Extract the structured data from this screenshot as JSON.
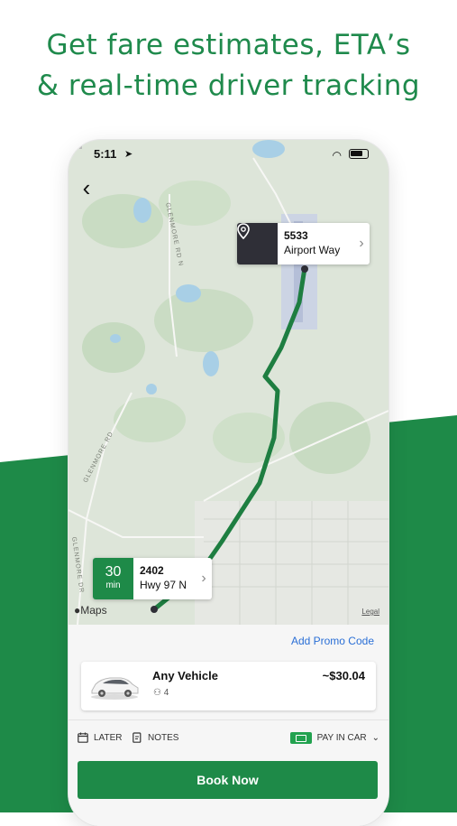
{
  "headline": {
    "line1": "Get fare estimates, ETA’s",
    "line2": "& real-time driver tracking"
  },
  "colors": {
    "brand_green": "#1e8a48",
    "headline_green": "#1f8a4c",
    "link_blue": "#2a6fd6",
    "dest_icon_bg": "#2f2f37"
  },
  "status_bar": {
    "time": "5:11"
  },
  "map": {
    "destination": {
      "line1": "5533",
      "line2": "Airport Way"
    },
    "origin": {
      "eta_value": "30",
      "eta_unit": "min",
      "line1": "2402",
      "line2": "Hwy 97 N"
    },
    "maps_label": "Maps",
    "legal_label": "Legal",
    "road_labels": [
      "GLENMORE RD N",
      "GLENMORE RD",
      "GLENMORE DR"
    ]
  },
  "sheet": {
    "promo_label": "Add Promo Code",
    "vehicle": {
      "name": "Any Vehicle",
      "seats": "4",
      "price": "~$30.04"
    },
    "options": {
      "later": "LATER",
      "notes": "NOTES",
      "payment": "PAY IN CAR"
    },
    "book_label": "Book Now"
  },
  "icons": [
    "location-arrow-icon",
    "signal-icon",
    "wifi-icon",
    "battery-icon",
    "back-chevron-icon",
    "location-pin-icon",
    "chevron-right-icon",
    "apple-icon",
    "car-icon",
    "person-icon",
    "calendar-icon",
    "notes-icon",
    "cash-icon",
    "chevron-down-icon"
  ]
}
